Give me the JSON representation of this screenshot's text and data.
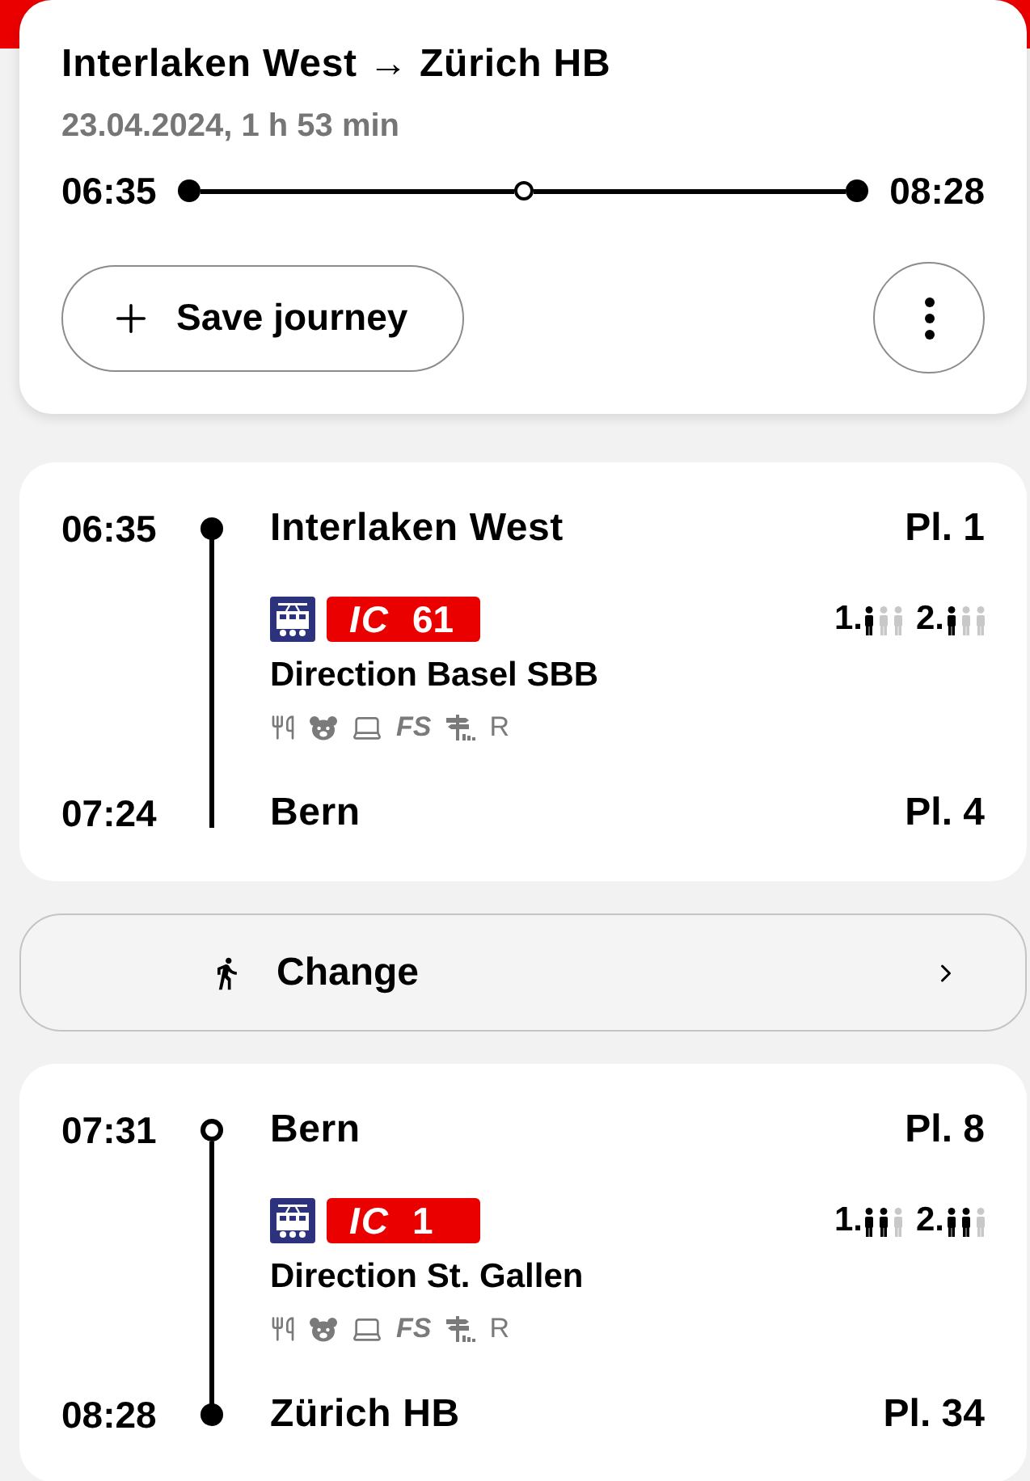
{
  "summary": {
    "title": "Interlaken West → Zürich HB",
    "meta": "23.04.2024, 1 h 53 min",
    "departure": "06:35",
    "arrival": "08:28",
    "timeline": [
      {
        "hollow": false
      },
      {
        "hollow": true
      },
      {
        "hollow": false
      }
    ],
    "save_button": "Save journey"
  },
  "sections": [
    {
      "kind": "leg",
      "departure": {
        "time": "06:35",
        "station": "Interlaken West",
        "platform": "Pl. 1",
        "dot": true,
        "hollow": false
      },
      "product": {
        "category": "IC",
        "line": "61"
      },
      "occupancy": [
        {
          "class": "1.",
          "people": [
            {
              "filled": true
            },
            {
              "filled": false
            },
            {
              "filled": false
            }
          ]
        },
        {
          "class": "2.",
          "people": [
            {
              "filled": true
            },
            {
              "filled": false
            },
            {
              "filled": false
            }
          ]
        }
      ],
      "direction": "Direction Basel SBB",
      "service_codes": [
        "FS",
        "R"
      ],
      "arrival": {
        "time": "07:24",
        "station": "Bern",
        "platform": "Pl. 4",
        "dot": false
      }
    },
    {
      "kind": "change",
      "label": "Change"
    },
    {
      "kind": "leg",
      "departure": {
        "time": "07:31",
        "station": "Bern",
        "platform": "Pl. 8",
        "dot": true,
        "hollow": true
      },
      "product": {
        "category": "IC",
        "line": "1"
      },
      "occupancy": [
        {
          "class": "1.",
          "people": [
            {
              "filled": true
            },
            {
              "filled": true
            },
            {
              "filled": false
            }
          ]
        },
        {
          "class": "2.",
          "people": [
            {
              "filled": true
            },
            {
              "filled": true
            },
            {
              "filled": false
            }
          ]
        }
      ],
      "direction": "Direction St. Gallen",
      "service_codes": [
        "FS",
        "R"
      ],
      "arrival": {
        "time": "08:28",
        "station": "Zürich HB",
        "platform": "Pl. 34",
        "dot": true,
        "hollow": false
      }
    }
  ]
}
